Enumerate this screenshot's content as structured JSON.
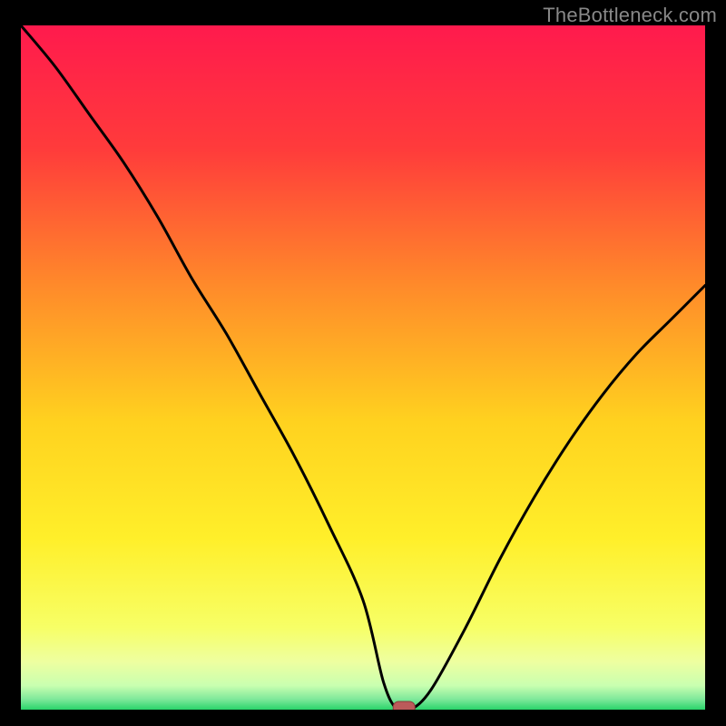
{
  "watermark": "TheBottleneck.com",
  "colors": {
    "frame": "#000000",
    "curve": "#000000",
    "marker_fill": "#bb5a5a",
    "marker_stroke": "#8a3a3a",
    "gradient_stops": [
      {
        "offset": 0.0,
        "color": "#ff1a4d"
      },
      {
        "offset": 0.18,
        "color": "#ff3b3b"
      },
      {
        "offset": 0.38,
        "color": "#ff8a2a"
      },
      {
        "offset": 0.58,
        "color": "#ffd21f"
      },
      {
        "offset": 0.75,
        "color": "#ffef2a"
      },
      {
        "offset": 0.88,
        "color": "#f7ff66"
      },
      {
        "offset": 0.93,
        "color": "#eeffa0"
      },
      {
        "offset": 0.965,
        "color": "#c9ffb0"
      },
      {
        "offset": 0.985,
        "color": "#7de89a"
      },
      {
        "offset": 1.0,
        "color": "#29d46a"
      }
    ]
  },
  "chart_data": {
    "type": "line",
    "title": "",
    "xlabel": "",
    "ylabel": "",
    "xlim": [
      0,
      100
    ],
    "ylim": [
      0,
      100
    ],
    "x": [
      0,
      5,
      10,
      15,
      20,
      25,
      30,
      35,
      40,
      45,
      50,
      53,
      55,
      57,
      60,
      65,
      70,
      75,
      80,
      85,
      90,
      95,
      100
    ],
    "values": [
      100,
      94,
      87,
      80,
      72,
      63,
      55,
      46,
      37,
      27,
      16,
      4,
      0,
      0,
      3,
      12,
      22,
      31,
      39,
      46,
      52,
      57,
      62
    ],
    "marker": {
      "x": 56,
      "y": 0,
      "shape": "rounded-rect"
    },
    "notes": "V-shaped curve descending from top-left to a minimum near x≈56 (y=0) then rising toward upper-right. Background is a vertical spectral gradient (red→orange→yellow→pale→green)."
  }
}
